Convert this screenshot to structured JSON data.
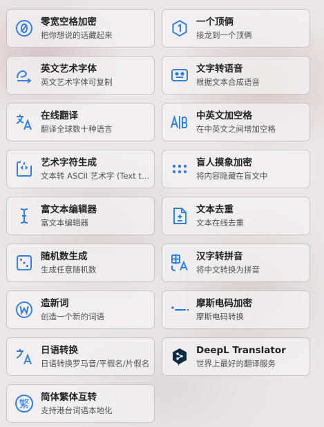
{
  "tools": [
    {
      "title": "零宽空格加密",
      "desc": "把你想说的话藏起来",
      "icon": "zero-width-icon"
    },
    {
      "title": "一个顶俩",
      "desc": "接龙到一个顶俩",
      "icon": "hexagon-one-icon"
    },
    {
      "title": "英文艺术字体",
      "desc": "英文艺术字体可复制",
      "icon": "art-font-icon"
    },
    {
      "title": "文字转语音",
      "desc": "根据文本合成语音",
      "icon": "text-to-speech-icon"
    },
    {
      "title": "在线翻译",
      "desc": "翻译全球数十种语言",
      "icon": "translate-icon"
    },
    {
      "title": "中英文加空格",
      "desc": "在中英文之间增加空格",
      "icon": "a-b-spacing-icon"
    },
    {
      "title": "艺术字符生成",
      "desc": "文本转 ASCII 艺术字 (Text to ASCII)",
      "icon": "code-box-icon"
    },
    {
      "title": "盲人摸象加密",
      "desc": "将内容隐藏在盲文中",
      "icon": "braille-icon"
    },
    {
      "title": "富文本编辑器",
      "desc": "富文本编辑器",
      "icon": "text-cursor-icon"
    },
    {
      "title": "文本去重",
      "desc": "文本在线去重",
      "icon": "file-dedupe-icon"
    },
    {
      "title": "随机数生成",
      "desc": "生成任意随机数",
      "icon": "dice-icon"
    },
    {
      "title": "汉字转拼音",
      "desc": "将中文转换为拼音",
      "icon": "pinyin-icon"
    },
    {
      "title": "造新词",
      "desc": "创造一个新的词语",
      "icon": "w-circle-icon"
    },
    {
      "title": "摩斯电码加密",
      "desc": "摩斯电码转换",
      "icon": "morse-icon"
    },
    {
      "title": "日语转换",
      "desc": "日语转换罗马音/平假名/片假名",
      "icon": "japanese-icon"
    },
    {
      "title": "DeepL Translator",
      "desc": "世界上最好的翻译服务",
      "icon": "deepl-logo-icon"
    },
    {
      "title": "简体繁体互转",
      "desc": "支持港台词语本地化",
      "icon": "traditional-chinese-icon"
    }
  ],
  "colors": {
    "accent": "#2f7fdc",
    "deepl": "#0f2b46"
  }
}
